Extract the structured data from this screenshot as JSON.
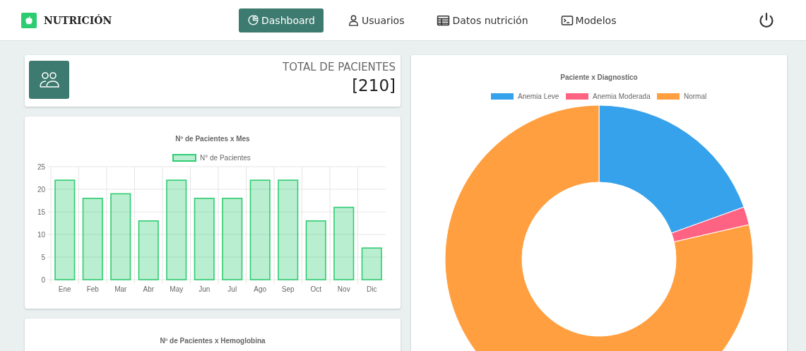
{
  "brand": {
    "name": "NUTRICIÓN"
  },
  "nav": [
    {
      "label": "Dashboard",
      "selected": true
    },
    {
      "label": "Usuarios",
      "selected": false
    },
    {
      "label": "Datos nutrición",
      "selected": false
    },
    {
      "label": "Modelos",
      "selected": false
    }
  ],
  "total_card": {
    "label": "TOTAL DE PACIENTES",
    "value": "[210]"
  },
  "monthly_card": {
    "chart_data": {
      "type": "bar",
      "title": "Nº de Pacientes x Mes",
      "categories": [
        "Ene",
        "Feb",
        "Mar",
        "Abr",
        "May",
        "Jun",
        "Jul",
        "Ago",
        "Sep",
        "Oct",
        "Nov",
        "Dic"
      ],
      "series": [
        {
          "name": "N° de Pacientes",
          "color": "#2ecc71",
          "values": [
            22,
            18,
            19,
            13,
            22,
            18,
            18,
            22,
            22,
            13,
            16,
            7
          ]
        }
      ],
      "ylim": [
        0,
        25
      ],
      "grid": true,
      "legend": true,
      "yticks": [
        0,
        5,
        10,
        15,
        20,
        25
      ]
    }
  },
  "diagnosis_card": {
    "chart_data": {
      "type": "donut",
      "title": "Paciente x Diagnostico",
      "categories": [
        "Anemia Leve",
        "Anemia Moderada",
        "Normal"
      ],
      "values": [
        19.5,
        1.9,
        78.6
      ],
      "legend": true,
      "colors": [
        "#36a2eb",
        "#ff6384",
        "#ff9f40"
      ]
    }
  },
  "hemoglobin_card": {
    "title": "Nº de Pacientes x Hemoglobina"
  }
}
